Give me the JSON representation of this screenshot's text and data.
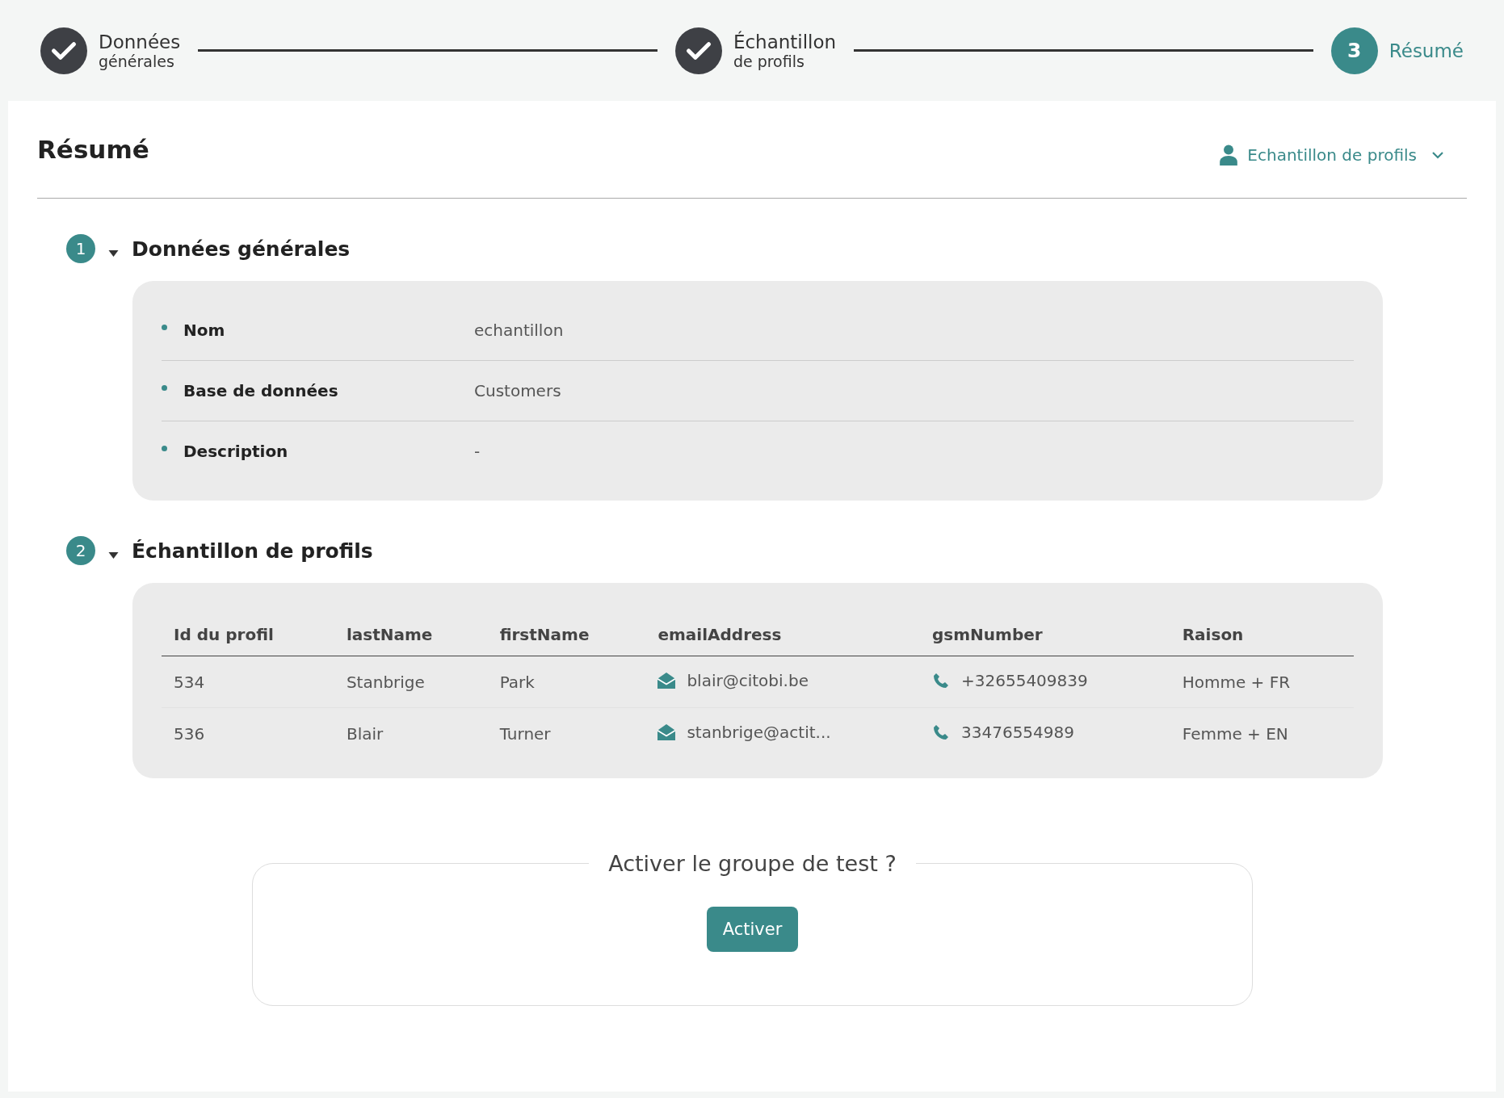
{
  "stepper": [
    {
      "kind": "done",
      "title": "Données",
      "subtitle": "générales"
    },
    {
      "kind": "done",
      "title": "Échantillon",
      "subtitle": "de profils"
    },
    {
      "kind": "current",
      "number": "3",
      "title": "Résumé"
    }
  ],
  "page_title": "Résumé",
  "profile_menu": {
    "label": "Echantillon de profils"
  },
  "sections": [
    {
      "number": "1",
      "title": "Données générales",
      "expanded": true,
      "kind": "details",
      "fields": [
        {
          "label": "Nom",
          "value": "echantillon"
        },
        {
          "label": "Base de données",
          "value": "Customers"
        },
        {
          "label": "Description",
          "value": "-"
        }
      ]
    },
    {
      "number": "2",
      "title": "Échantillon de profils",
      "expanded": true,
      "kind": "table",
      "columns": [
        "Id du profil",
        "lastName",
        "firstName",
        "emailAddress",
        "gsmNumber",
        "Raison"
      ],
      "rows": [
        [
          "534",
          "Stanbrige",
          "Park",
          "blair@citobi.be",
          "+32655409839",
          "Homme + FR"
        ],
        [
          "536",
          "Blair",
          "Turner",
          "stanbrige@actit...",
          "33476554989",
          "Femme + EN"
        ]
      ]
    }
  ],
  "activation": {
    "legend": "Activer le groupe de test ?",
    "button": "Activer"
  }
}
